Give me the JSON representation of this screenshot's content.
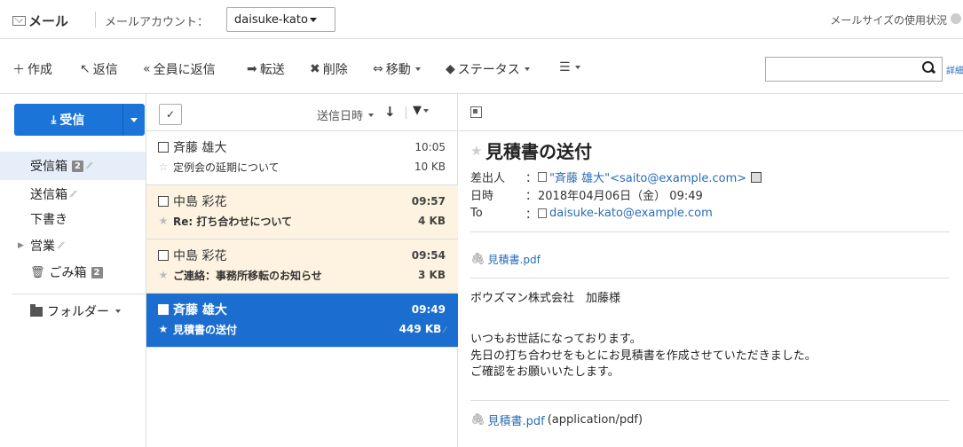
{
  "header": {
    "app_title": "メール",
    "account_label": "メールアカウント：",
    "account_value": "daisuke-kato",
    "size_link": "メールサイズの使用状況"
  },
  "toolbar": {
    "create": "作成",
    "reply": "返信",
    "reply_all": "全員に返信",
    "forward": "転送",
    "delete": "削除",
    "move": "移動",
    "status": "ステータス",
    "search_placeholder": "",
    "advanced_search": "詳細検索"
  },
  "nav": {
    "receive_label": "受信",
    "items": [
      {
        "label": "受信箱",
        "badge": "2"
      },
      {
        "label": "送信箱"
      },
      {
        "label": "下書き"
      },
      {
        "label": "営業"
      },
      {
        "label": "ごみ箱",
        "badge": "2"
      }
    ],
    "folder_label": "フォルダー"
  },
  "list": {
    "sort_label": "送信日時",
    "messages": [
      {
        "sender": "斉藤 雄大",
        "subject": "定例会の延期について",
        "time": "10:05",
        "size": "10 KB",
        "state": "read"
      },
      {
        "sender": "中島 彩花",
        "subject": "Re: 打ち合わせについて",
        "time": "09:57",
        "size": "4 KB",
        "state": "unread"
      },
      {
        "sender": "中島 彩花",
        "subject": "ご連絡：事務所移転のお知らせ",
        "time": "09:54",
        "size": "3 KB",
        "state": "unread"
      },
      {
        "sender": "斉藤 雄大",
        "subject": "見積書の送付",
        "time": "09:49",
        "size": "449 KB",
        "state": "active"
      }
    ]
  },
  "preview": {
    "subject": "見積書の送付",
    "from_label": "差出人",
    "from_value": "\"斉藤 雄大\"<saito@example.com>",
    "date_label": "日時",
    "date_value": "2018年04月06日（金） 09:49",
    "to_label": "To",
    "to_value": "daisuke-kato@example.com",
    "attachment_top": "見積書.pdf",
    "body_line1": "ボウズマン株式会社　加藤様",
    "body_line2": "いつもお世話になっております。",
    "body_line3": "先日の打ち合わせをもとにお見積書を作成させていただきました。",
    "body_line4": "ご確認をお願いいたします。",
    "attachment_bottom": "見積書.pdf",
    "attachment_bottom_type": "(application/pdf)"
  }
}
